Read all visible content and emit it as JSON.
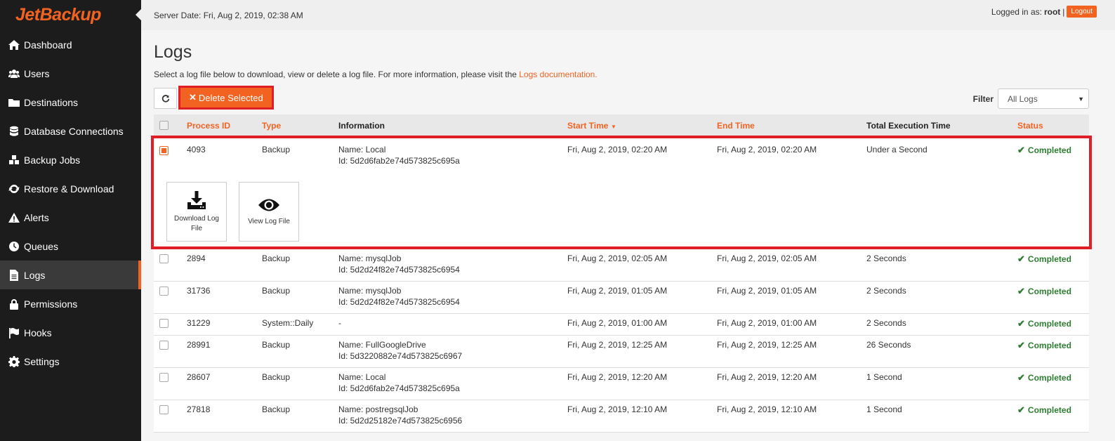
{
  "app": {
    "logo": "JetBackup"
  },
  "sidebar": {
    "items": [
      {
        "label": "Dashboard",
        "icon": "home-icon"
      },
      {
        "label": "Users",
        "icon": "users-icon"
      },
      {
        "label": "Destinations",
        "icon": "folder-icon"
      },
      {
        "label": "Database Connections",
        "icon": "database-icon"
      },
      {
        "label": "Backup Jobs",
        "icon": "cubes-icon"
      },
      {
        "label": "Restore & Download",
        "icon": "refresh-icon"
      },
      {
        "label": "Alerts",
        "icon": "warning-icon"
      },
      {
        "label": "Queues",
        "icon": "clock-icon"
      },
      {
        "label": "Logs",
        "icon": "file-icon",
        "active": true
      },
      {
        "label": "Permissions",
        "icon": "lock-icon"
      },
      {
        "label": "Hooks",
        "icon": "flag-icon"
      },
      {
        "label": "Settings",
        "icon": "gear-icon"
      }
    ]
  },
  "header": {
    "server_date": "Server Date: Fri, Aug 2, 2019, 02:38 AM",
    "logged_in_prefix": "Logged in as:",
    "user": "root",
    "separator": "|",
    "logout_label": "Logout"
  },
  "page": {
    "title": "Logs",
    "description": "Select a log file below to download, view or delete a log file. For more information, please visit the",
    "doc_link": "Logs documentation.",
    "delete_label": "Delete Selected",
    "filter_label": "Filter",
    "filter_value": "All Logs"
  },
  "table": {
    "columns": {
      "process_id": "Process ID",
      "type": "Type",
      "information": "Information",
      "start_time": "Start Time",
      "end_time": "End Time",
      "total": "Total Execution Time",
      "status": "Status"
    },
    "rows": [
      {
        "pid": "4093",
        "type": "Backup",
        "info1": "Name: Local",
        "info2": "Id: 5d2d6fab2e74d573825c695a",
        "start": "Fri, Aug 2, 2019, 02:20 AM",
        "end": "Fri, Aug 2, 2019, 02:20 AM",
        "total": "Under a Second",
        "status": "Completed",
        "checked": true
      },
      {
        "pid": "2894",
        "type": "Backup",
        "info1": "Name: mysqlJob",
        "info2": "Id: 5d2d24f82e74d573825c6954",
        "start": "Fri, Aug 2, 2019, 02:05 AM",
        "end": "Fri, Aug 2, 2019, 02:05 AM",
        "total": "2 Seconds",
        "status": "Completed"
      },
      {
        "pid": "31736",
        "type": "Backup",
        "info1": "Name: mysqlJob",
        "info2": "Id: 5d2d24f82e74d573825c6954",
        "start": "Fri, Aug 2, 2019, 01:05 AM",
        "end": "Fri, Aug 2, 2019, 01:05 AM",
        "total": "2 Seconds",
        "status": "Completed"
      },
      {
        "pid": "31229",
        "type": "System::Daily",
        "info1": "-",
        "info2": "",
        "start": "Fri, Aug 2, 2019, 01:00 AM",
        "end": "Fri, Aug 2, 2019, 01:00 AM",
        "total": "2 Seconds",
        "status": "Completed"
      },
      {
        "pid": "28991",
        "type": "Backup",
        "info1": "Name: FullGoogleDrive",
        "info2": "Id: 5d3220882e74d573825c6967",
        "start": "Fri, Aug 2, 2019, 12:25 AM",
        "end": "Fri, Aug 2, 2019, 12:25 AM",
        "total": "26 Seconds",
        "status": "Completed"
      },
      {
        "pid": "28607",
        "type": "Backup",
        "info1": "Name: Local",
        "info2": "Id: 5d2d6fab2e74d573825c695a",
        "start": "Fri, Aug 2, 2019, 12:20 AM",
        "end": "Fri, Aug 2, 2019, 12:20 AM",
        "total": "1 Second",
        "status": "Completed"
      },
      {
        "pid": "27818",
        "type": "Backup",
        "info1": "Name: postregsqlJob",
        "info2": "Id: 5d2d25182e74d573825c6956",
        "start": "Fri, Aug 2, 2019, 12:10 AM",
        "end": "Fri, Aug 2, 2019, 12:10 AM",
        "total": "1 Second",
        "status": "Completed"
      }
    ],
    "actions": {
      "download_line1": "Download Log",
      "download_line2": "File",
      "view": "View Log File"
    }
  },
  "colors": {
    "accent": "#f26322",
    "highlight": "#e01e25",
    "success": "#2e7d32",
    "sidebar": "#1c1c1c"
  }
}
